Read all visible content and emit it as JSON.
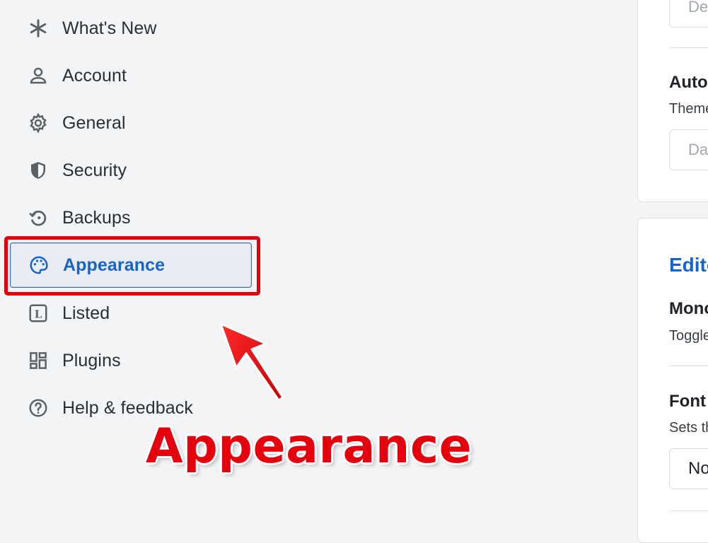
{
  "sidebar": {
    "items": [
      {
        "label": "What's New",
        "icon": "asterisk-icon"
      },
      {
        "label": "Account",
        "icon": "person-icon"
      },
      {
        "label": "General",
        "icon": "gear-icon"
      },
      {
        "label": "Security",
        "icon": "shield-icon"
      },
      {
        "label": "Backups",
        "icon": "history-icon"
      },
      {
        "label": "Appearance",
        "icon": "palette-icon",
        "active": true
      },
      {
        "label": "Listed",
        "icon": "listed-icon"
      },
      {
        "label": "Plugins",
        "icon": "plugins-icon"
      },
      {
        "label": "Help & feedback",
        "icon": "help-icon"
      }
    ]
  },
  "annotation": {
    "text": "Appearance",
    "color": "#e6000d"
  },
  "panel": {
    "top_field_value": "De",
    "auto_title": "Auto",
    "auto_desc": "Theme",
    "auto_field_value": "Da",
    "editor_section_title": "Edito",
    "mono_title": "Mono",
    "mono_desc": "Toggle",
    "font_title": "Font",
    "font_desc": "Sets th",
    "font_field_value": "No"
  },
  "colors": {
    "accent": "#1664c8",
    "highlight": "#e0000b"
  }
}
